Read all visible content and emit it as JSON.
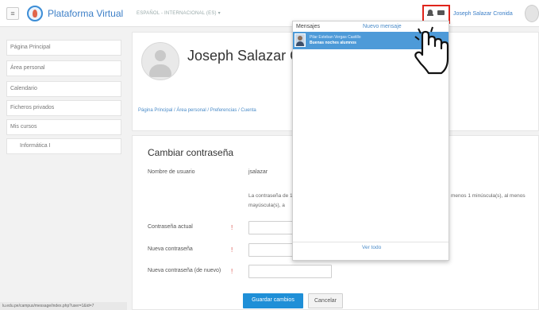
{
  "navbar": {
    "brand": "Plataforma Virtual",
    "language": "ESPAÑOL - INTERNACIONAL (ES) ▾",
    "username": "Joseph Salazar Cronida"
  },
  "sidebar": {
    "items": [
      {
        "label": "Página Principal"
      },
      {
        "label": "Área personal"
      },
      {
        "label": "Calendario"
      },
      {
        "label": "Ficheros privados"
      },
      {
        "label": "Mis cursos"
      },
      {
        "label": "Informática I"
      }
    ],
    "status_url": "lu.edu.pe/campus/message/index.php?user=1&id=7"
  },
  "profile": {
    "name": "Joseph Salazar C"
  },
  "breadcrumb": "Página Principal / Área personal / Preferencias / Cuenta",
  "form": {
    "title": "Cambiar contraseña",
    "username_label": "Nombre de usuario",
    "username_value": "jsalazar",
    "policy_text": "La contraseña de 1 mayúscula(s), a",
    "policy_text_right": "menos 1 minúscula(s), al menos",
    "current_label": "Contraseña actual",
    "new_label": "Nueva contraseña",
    "repeat_label": "Nueva contraseña (de nuevo)",
    "required_mark": "!",
    "save_label": "Guardar cambios",
    "cancel_label": "Cancelar"
  },
  "messages": {
    "title": "Mensajes",
    "new_message": "Nuevo mensaje",
    "items": [
      {
        "sender": "Pilar Esteban Vergas Castillo",
        "preview": "Buenas noches alumnos"
      }
    ],
    "view_all": "Ver todo"
  }
}
